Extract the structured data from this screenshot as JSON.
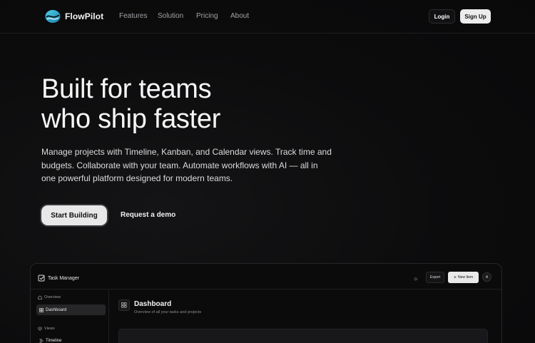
{
  "brand": {
    "name": "FlowPilot",
    "logo_icon": "wave-logo-icon",
    "accent": "#29b6d6"
  },
  "nav": {
    "links": [
      "Features",
      "Solution",
      "Pricing",
      "About"
    ],
    "login_label": "Login",
    "signup_label": "Sign Up"
  },
  "hero": {
    "title_line1": "Built for teams",
    "title_line2": "who ship faster",
    "description": "Manage projects with Timeline, Kanban, and Calendar views. Track time and budgets. Collaborate with your team. Automate workflows with AI — all in one powerful platform designed for modern teams.",
    "primary_cta": "Start Building",
    "secondary_cta": "Request a demo"
  },
  "preview": {
    "app_title": "Task Manager",
    "app_icon": "checkbox-icon",
    "theme_icon": "sun-icon",
    "export_label": "Export",
    "new_item_label": "New Item",
    "avatar_initial": "A",
    "sidebar": {
      "overview_label": "Overview",
      "dashboard_item": "Dashboard",
      "views_label": "Views",
      "timeline_item": "Timeline"
    },
    "dashboard": {
      "title": "Dashboard",
      "subtitle": "Overview of all your tasks and projects"
    }
  }
}
